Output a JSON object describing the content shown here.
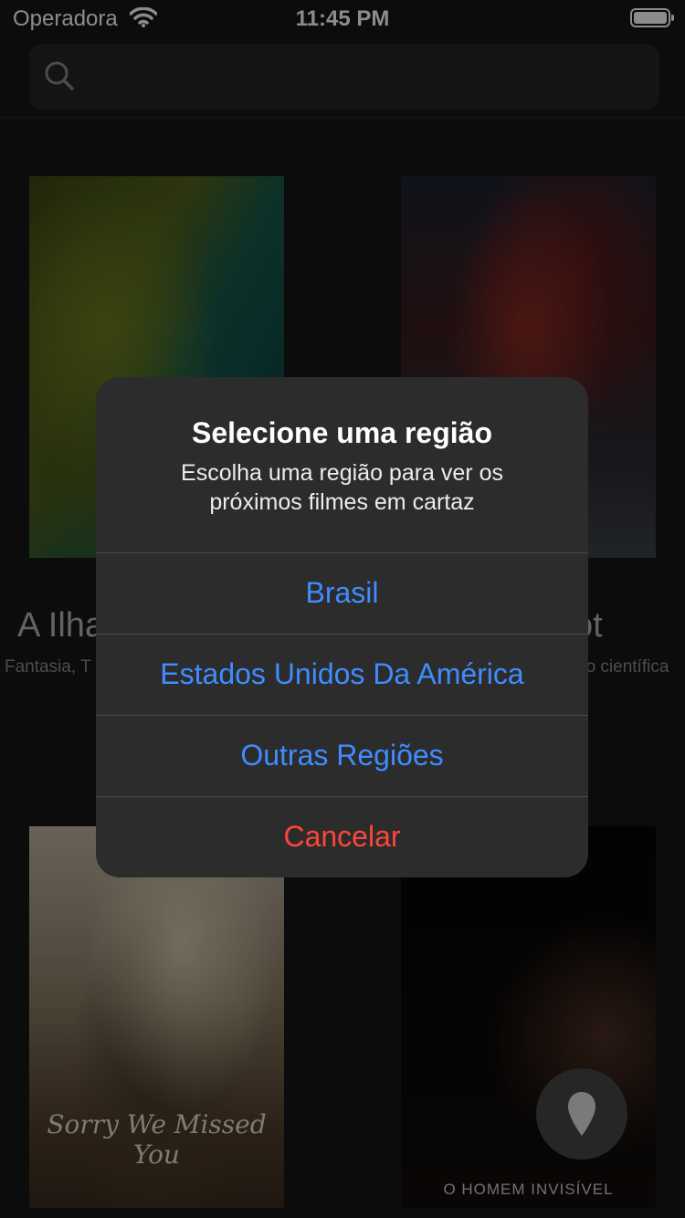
{
  "status_bar": {
    "carrier": "Operadora",
    "time": "11:45 PM"
  },
  "search": {
    "placeholder": ""
  },
  "movies": [
    {
      "title": "A Ilha",
      "genre": "Fantasia, T"
    },
    {
      "title": "ot",
      "genre": "ão científica"
    },
    {
      "poster_text": "Sorry We Missed You"
    },
    {
      "poster_text": "O HOMEM INVISÍVEL"
    }
  ],
  "alert": {
    "title": "Selecione uma região",
    "message": "Escolha uma região para ver os próximos filmes em cartaz",
    "options": [
      "Brasil",
      "Estados Unidos Da América",
      "Outras Regiões"
    ],
    "cancel": "Cancelar"
  },
  "colors": {
    "action": "#3f8cff",
    "destructive": "#ff453a",
    "alert_bg": "#2c2c2c"
  },
  "icons": [
    "wifi-icon",
    "battery-icon",
    "search-icon",
    "map-pin-icon"
  ]
}
